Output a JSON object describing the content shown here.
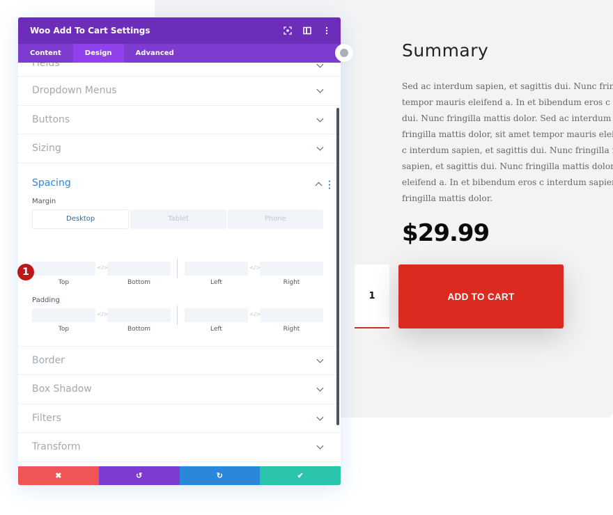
{
  "modal": {
    "title": "Woo Add To Cart Settings",
    "header_icons": [
      "focus-icon",
      "split-view-icon",
      "more-options-icon"
    ],
    "tabs": [
      {
        "label": "Content",
        "active": false
      },
      {
        "label": "Design",
        "active": true
      },
      {
        "label": "Advanced",
        "active": false
      }
    ],
    "groups_above": [
      {
        "label": "Fields"
      },
      {
        "label": "Dropdown Menus"
      },
      {
        "label": "Buttons"
      },
      {
        "label": "Sizing"
      }
    ],
    "spacing": {
      "title": "Spacing",
      "margin_label": "Margin",
      "padding_label": "Padding",
      "devices": [
        "Desktop",
        "Tablet",
        "Phone"
      ],
      "active_device": "Desktop",
      "margin": {
        "top": "",
        "bottom": "",
        "left": "",
        "right": ""
      },
      "padding": {
        "top": "",
        "bottom": "",
        "left": "",
        "right": ""
      },
      "captions": [
        "Top",
        "Bottom",
        "Left",
        "Right"
      ],
      "link_glyph": "</>"
    },
    "groups_below": [
      {
        "label": "Border"
      },
      {
        "label": "Box Shadow"
      },
      {
        "label": "Filters"
      },
      {
        "label": "Transform"
      }
    ],
    "footer": {
      "discard_glyph": "✖",
      "undo_glyph": "↺",
      "redo_glyph": "↻",
      "save_glyph": "✔"
    }
  },
  "annotation": {
    "step": "1"
  },
  "preview": {
    "title": "Summary",
    "paragraph_lines": [
      "Sed ac interdum sapien, et sagittis dui. Nunc fringilla matt",
      "tempor mauris eleifend a. In et bibendum eros c interdum",
      "dui. Nunc fringilla mattis dolor. Sed ac interdum sapien, et",
      "fringilla mattis dolor, sit amet tempor mauris eleifend a. In",
      "c interdum sapien, et sagittis dui. Nunc fringilla mattis dolor",
      "sapien, et sagittis dui. Nunc fringilla mattis dolor, sit ame",
      "eleifend a. In et bibendum eros c interdum sapien, et s",
      "fringilla mattis dolor."
    ],
    "price": "$29.99",
    "quantity": "1",
    "add_to_cart_label": "ADD TO CART"
  },
  "colors": {
    "header_purple": "#6c2eb9",
    "tab_purple": "#7e3bd0",
    "active_tab": "#8f42ec",
    "accent_blue": "#2b87da",
    "discard_red": "#ef5555",
    "save_green": "#29c4a9",
    "cart_red": "#dd2a21"
  }
}
